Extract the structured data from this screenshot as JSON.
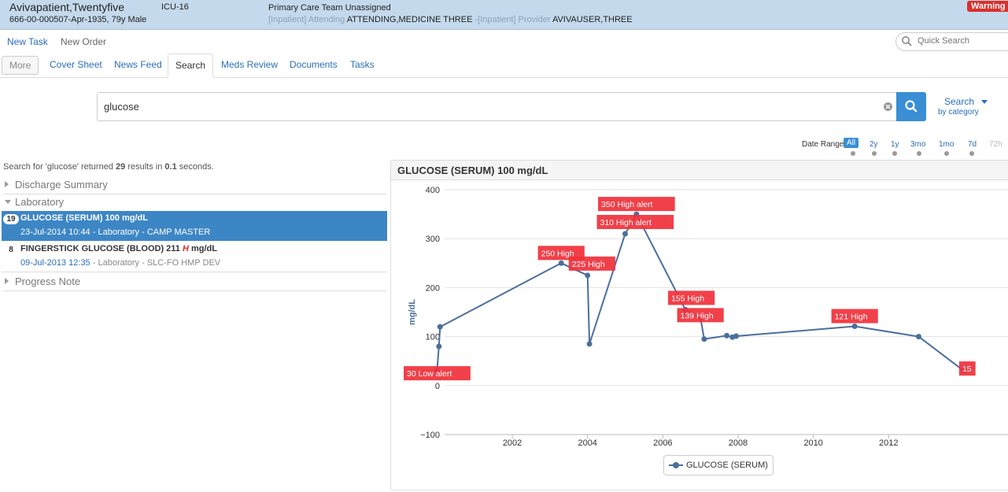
{
  "header": {
    "patient_name": "Avivapatient,Twentyfive",
    "patient_id": "666-00-000507-Apr-1935, 79y Male",
    "unit": "ICU-16",
    "primary_care": "Primary Care Team Unassigned",
    "attending_prefix": "[Inpatient] Attending",
    "attending_name": "ATTENDING,MEDICINE THREE",
    "provider_prefix": "-[Inpatient] Provider",
    "provider_name": "AVIVAUSER,THREE",
    "warning": "Warning M",
    "warning_color": "#d9302c"
  },
  "actions": {
    "new_task": "New Task",
    "new_order": "New Order"
  },
  "quick_search": {
    "placeholder": "Quick Search"
  },
  "tabs": [
    {
      "label": "More"
    },
    {
      "label": "Cover Sheet"
    },
    {
      "label": "News Feed"
    },
    {
      "label": "Search"
    },
    {
      "label": "Meds Review"
    },
    {
      "label": "Documents"
    },
    {
      "label": "Tasks"
    }
  ],
  "search": {
    "value": "glucose",
    "button_icon": "search-icon",
    "category_label": "Search",
    "category_sub": "by category"
  },
  "date_range": {
    "label": "Date Range",
    "options": [
      "All",
      "2y",
      "1y",
      "3mo",
      "1mo",
      "7d",
      "72h"
    ],
    "selected": "All"
  },
  "results": {
    "summary_prefix": "Search for 'glucose' returned",
    "count": "29",
    "summary_mid": "results in",
    "time": "0.1",
    "summary_suffix": "seconds.",
    "groups": [
      {
        "label": "Discharge Summary"
      },
      {
        "label": "Laboratory"
      },
      {
        "label": "Progress Note"
      }
    ],
    "items": [
      {
        "count": "19",
        "title": "GLUCOSE (SERUM) 100 mg/dL",
        "date": "23-Jul-2014 10:44",
        "source": "- Laboratory - CAMP MASTER"
      },
      {
        "count": "8",
        "title_pre": "FINGERSTICK GLUCOSE (BLOOD) 211",
        "flag": "H",
        "title_post": "mg/dL",
        "date": "09-Jul-2013 12:35",
        "source": "- Laboratory - SLC-FO HMP DEV"
      }
    ]
  },
  "chart_panel": {
    "title": "GLUCOSE (SERUM) 100 mg/dL"
  },
  "chart_data": {
    "type": "line",
    "title": "",
    "xlabel": "",
    "ylabel": "mg/dL",
    "ylim": [
      -100,
      400
    ],
    "yticks": [
      -100,
      0,
      100,
      200,
      300,
      400
    ],
    "xticks": [
      2002,
      2004,
      2006,
      2008,
      2010,
      2012
    ],
    "xtick_extra": "2",
    "xlim": [
      2000.2,
      2015.3
    ],
    "grid": true,
    "legend_position": "bottom-center",
    "line_color": "#4a6f9c",
    "alert_color": "#f0303a",
    "series": [
      {
        "name": "GLUCOSE (SERUM)",
        "points": [
          {
            "x": 2000.0,
            "y": 30,
            "label": "30 Low alert"
          },
          {
            "x": 2000.05,
            "y": 80
          },
          {
            "x": 2000.08,
            "y": 120
          },
          {
            "x": 2003.3,
            "y": 250,
            "label": "250 High"
          },
          {
            "x": 2004.0,
            "y": 225,
            "label": "225 High"
          },
          {
            "x": 2004.05,
            "y": 85
          },
          {
            "x": 2005.0,
            "y": 310,
            "label": "310 High alert"
          },
          {
            "x": 2005.3,
            "y": 350,
            "label": "350 High alert"
          },
          {
            "x": 2006.6,
            "y": 155,
            "label": "155 High"
          },
          {
            "x": 2007.0,
            "y": 139,
            "label": "139 High"
          },
          {
            "x": 2007.1,
            "y": 95
          },
          {
            "x": 2007.7,
            "y": 102
          },
          {
            "x": 2007.85,
            "y": 99
          },
          {
            "x": 2007.95,
            "y": 101
          },
          {
            "x": 2011.1,
            "y": 121,
            "label": "121 High"
          },
          {
            "x": 2012.8,
            "y": 100
          },
          {
            "x": 2014.0,
            "y": 30,
            "label": "15"
          }
        ]
      }
    ]
  }
}
